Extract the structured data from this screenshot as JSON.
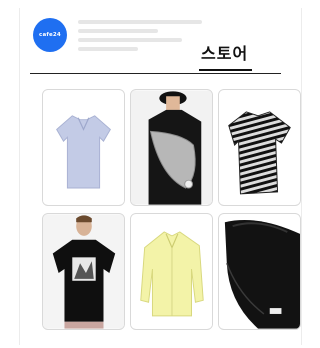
{
  "brand": {
    "logo_text": "cafe24",
    "accent_color": "#1f6ff1"
  },
  "header": {
    "tab_label": "스토어"
  },
  "products": [
    {
      "name": "lavender-polo-shirt-icon"
    },
    {
      "name": "grey-crossbody-bag-model-icon"
    },
    {
      "name": "striped-tshirt-icon"
    },
    {
      "name": "graphic-tshirt-model-icon"
    },
    {
      "name": "yellow-shirt-icon"
    },
    {
      "name": "black-nylon-bag-icon"
    }
  ]
}
